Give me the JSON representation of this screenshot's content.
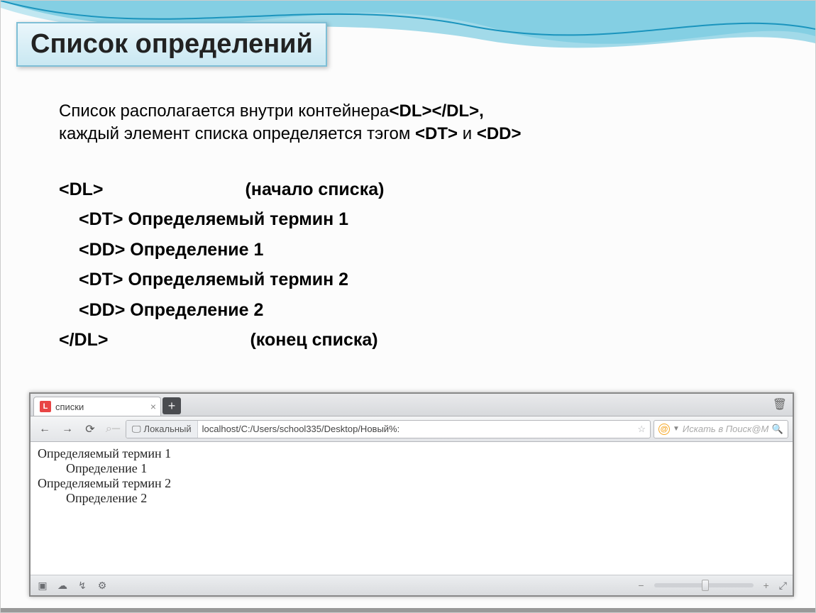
{
  "slide": {
    "title": "Список определений",
    "intro_line1_a": "Список располагается внутри контейнера",
    "intro_line1_b": "<DL></DL>,",
    "intro_line2_a": "каждый элемент списка определяется тэгом ",
    "intro_line2_b": "<DT>",
    "intro_line2_c": " и ",
    "intro_line2_d": "<DD>",
    "code": {
      "l1a": "<DL>",
      "l1b": "(начало списка)",
      "l2": "<DT> Определяемый термин 1",
      "l3": "<DD> Определение 1",
      "l4": "<DT> Определяемый термин 2",
      "l5": "<DD> Определение 2",
      "l6a": "</DL>",
      "l6b": "(конец списка)"
    }
  },
  "browser": {
    "tab_title": "списки",
    "trash_icon": "🗑",
    "badge_label": "Локальный",
    "address": "localhost/C:/Users/school335/Desktop/Новый%:",
    "search_placeholder": "Искать в Поиск@М",
    "page": {
      "dt1": "Определяемый термин 1",
      "dd1": "Определение 1",
      "dt2": "Определяемый термин 2",
      "dd2": "Определение 2"
    }
  }
}
